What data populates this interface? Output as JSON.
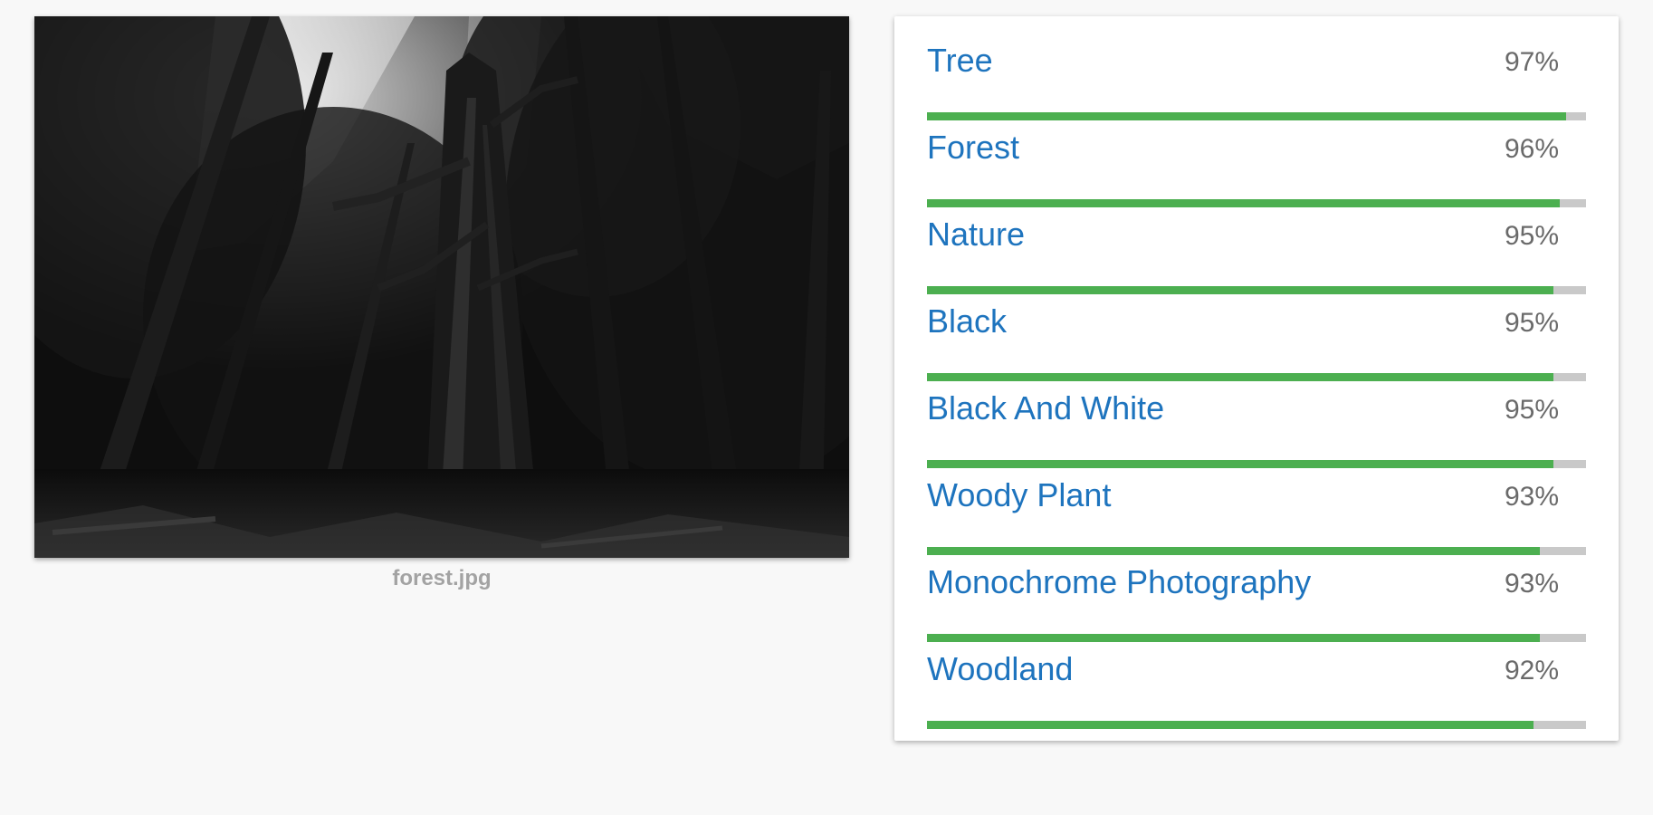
{
  "image": {
    "filename": "forest.jpg"
  },
  "colors": {
    "label_text": "#1e74be",
    "score_text": "#6a6a6a",
    "bar_fill": "#4caf50",
    "bar_track": "#c9c9c9"
  },
  "labels": [
    {
      "name": "Tree",
      "score": "97%",
      "confidence": 0.97
    },
    {
      "name": "Forest",
      "score": "96%",
      "confidence": 0.96
    },
    {
      "name": "Nature",
      "score": "95%",
      "confidence": 0.95
    },
    {
      "name": "Black",
      "score": "95%",
      "confidence": 0.95
    },
    {
      "name": "Black And White",
      "score": "95%",
      "confidence": 0.95
    },
    {
      "name": "Woody Plant",
      "score": "93%",
      "confidence": 0.93
    },
    {
      "name": "Monochrome Photography",
      "score": "93%",
      "confidence": 0.93
    },
    {
      "name": "Woodland",
      "score": "92%",
      "confidence": 0.92
    }
  ]
}
